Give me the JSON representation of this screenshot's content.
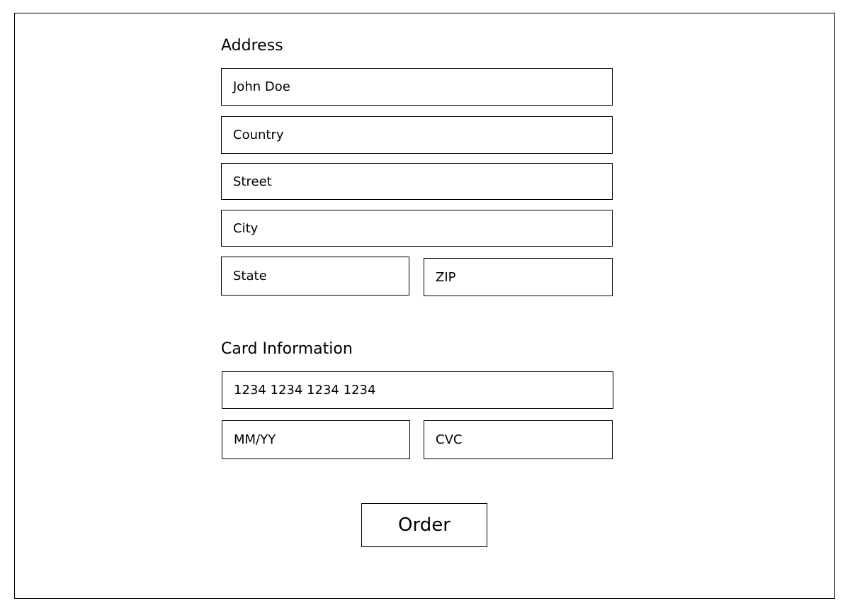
{
  "address": {
    "heading": "Address",
    "name": "John Doe",
    "country": "Country",
    "street": "Street",
    "city": "City",
    "state": "State",
    "zip": "ZIP"
  },
  "card": {
    "heading": "Card Information",
    "number": "1234 1234 1234 1234",
    "expiry": "MM/YY",
    "cvc": "CVC"
  },
  "order_label": "Order"
}
